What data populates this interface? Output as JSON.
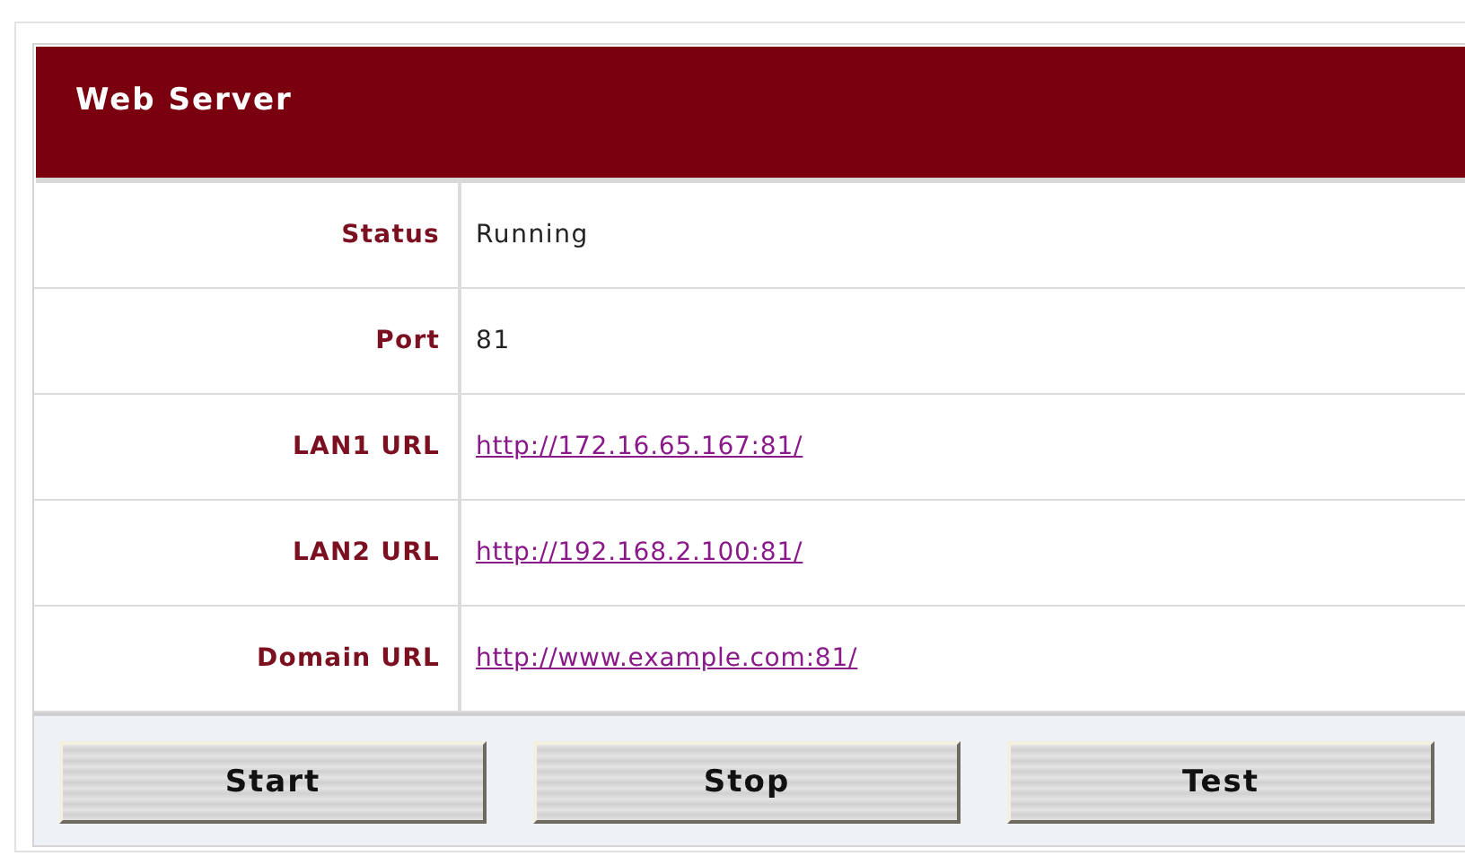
{
  "panel": {
    "title": "Web Server"
  },
  "rows": [
    {
      "label": "Status",
      "value": "Running",
      "kind": "text"
    },
    {
      "label": "Port",
      "value": "81",
      "kind": "text"
    },
    {
      "label": "LAN1 URL",
      "value": "http://172.16.65.167:81/",
      "kind": "link"
    },
    {
      "label": "LAN2 URL",
      "value": "http://192.168.2.100:81/",
      "kind": "link"
    },
    {
      "label": "Domain URL",
      "value": "http://www.example.com:81/",
      "kind": "link"
    }
  ],
  "buttons": [
    "Start",
    "Stop",
    "Test"
  ]
}
